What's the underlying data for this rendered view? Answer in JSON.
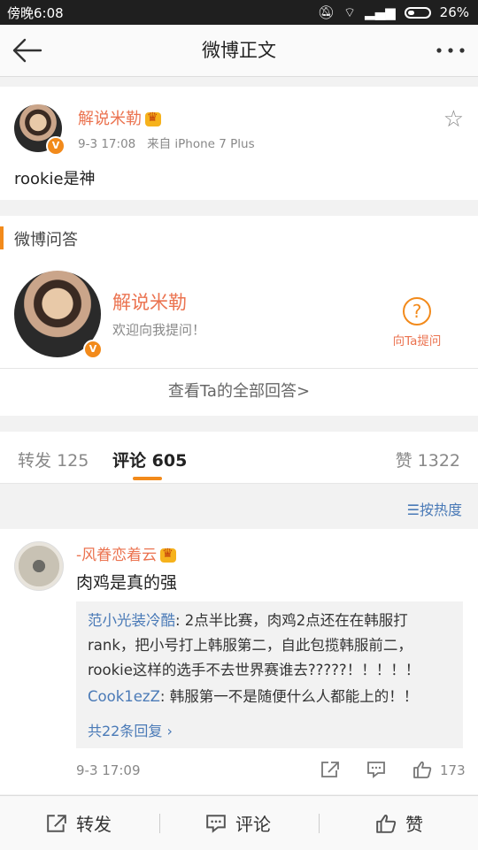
{
  "status_bar": {
    "time": "傍晚6:08",
    "battery": "26%"
  },
  "nav": {
    "title": "微博正文"
  },
  "post": {
    "author": "解说米勒",
    "time": "9-3 17:08",
    "source": "来自 iPhone 7 Plus",
    "text": "rookie是神"
  },
  "qa": {
    "section_title": "微博问答",
    "name": "解说米勒",
    "welcome": "欢迎向我提问！",
    "ask_label": "向Ta提问",
    "view_all": "查看Ta的全部回答>"
  },
  "tabs": {
    "repost_label": "转发",
    "repost_count": "125",
    "comment_label": "评论",
    "comment_count": "605",
    "like_label": "赞",
    "like_count": "1322"
  },
  "sort": {
    "label": "按热度"
  },
  "comment": {
    "author": "-风眷恋着云",
    "text": "肉鸡是真的强",
    "replies": [
      {
        "author": "范小光装冷酷",
        "text": ": 2点半比赛，肉鸡2点还在在韩服打rank，把小号打上韩服第二，自此包揽韩服前二，rookie这样的选手不去世界赛谁去?????！！！！！"
      },
      {
        "author": "Cook1ezZ",
        "text": ": 韩服第一不是随便什么人都能上的！！"
      }
    ],
    "more_replies": "共22条回复 ›",
    "time": "9-3 17:09",
    "like_count": "173"
  },
  "bottom_bar": {
    "repost": "转发",
    "comment": "评论",
    "like": "赞"
  }
}
